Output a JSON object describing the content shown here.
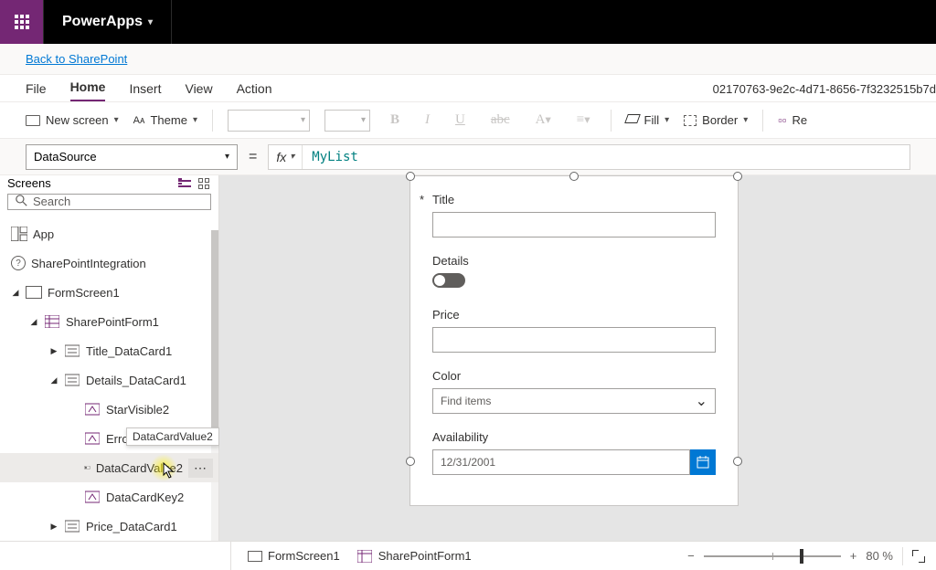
{
  "titlebar": {
    "app_name": "PowerApps"
  },
  "backbar": {
    "link": "Back to SharePoint"
  },
  "menubar": {
    "tabs": [
      "File",
      "Home",
      "Insert",
      "View",
      "Action"
    ],
    "active": "Home",
    "file_id": "02170763-9e2c-4d71-8656-7f3232515b7d"
  },
  "ribbon": {
    "new_screen": "New screen",
    "theme": "Theme",
    "fill": "Fill",
    "border": "Border",
    "reorder": "Re"
  },
  "formulabar": {
    "property": "DataSource",
    "fx_label": "fx",
    "formula": "MyList"
  },
  "treepanel": {
    "title": "Screens",
    "search_placeholder": "Search",
    "items": {
      "app": "App",
      "spi": "SharePointIntegration",
      "screen": "FormScreen1",
      "form": "SharePointForm1",
      "title_dc": "Title_DataCard1",
      "details_dc": "Details_DataCard1",
      "star": "StarVisible2",
      "error": "ErrorM",
      "dcv": "DataCardValue2",
      "dck": "DataCardKey2",
      "price_dc": "Price_DataCard1",
      "tooltip": "DataCardValue2"
    }
  },
  "canvas": {
    "title_label": "Title",
    "details_label": "Details",
    "price_label": "Price",
    "color_label": "Color",
    "color_placeholder": "Find items",
    "avail_label": "Availability",
    "avail_value": "12/31/2001"
  },
  "statusbar": {
    "bc1": "FormScreen1",
    "bc2": "SharePointForm1",
    "zoom_pct": "80 %"
  }
}
